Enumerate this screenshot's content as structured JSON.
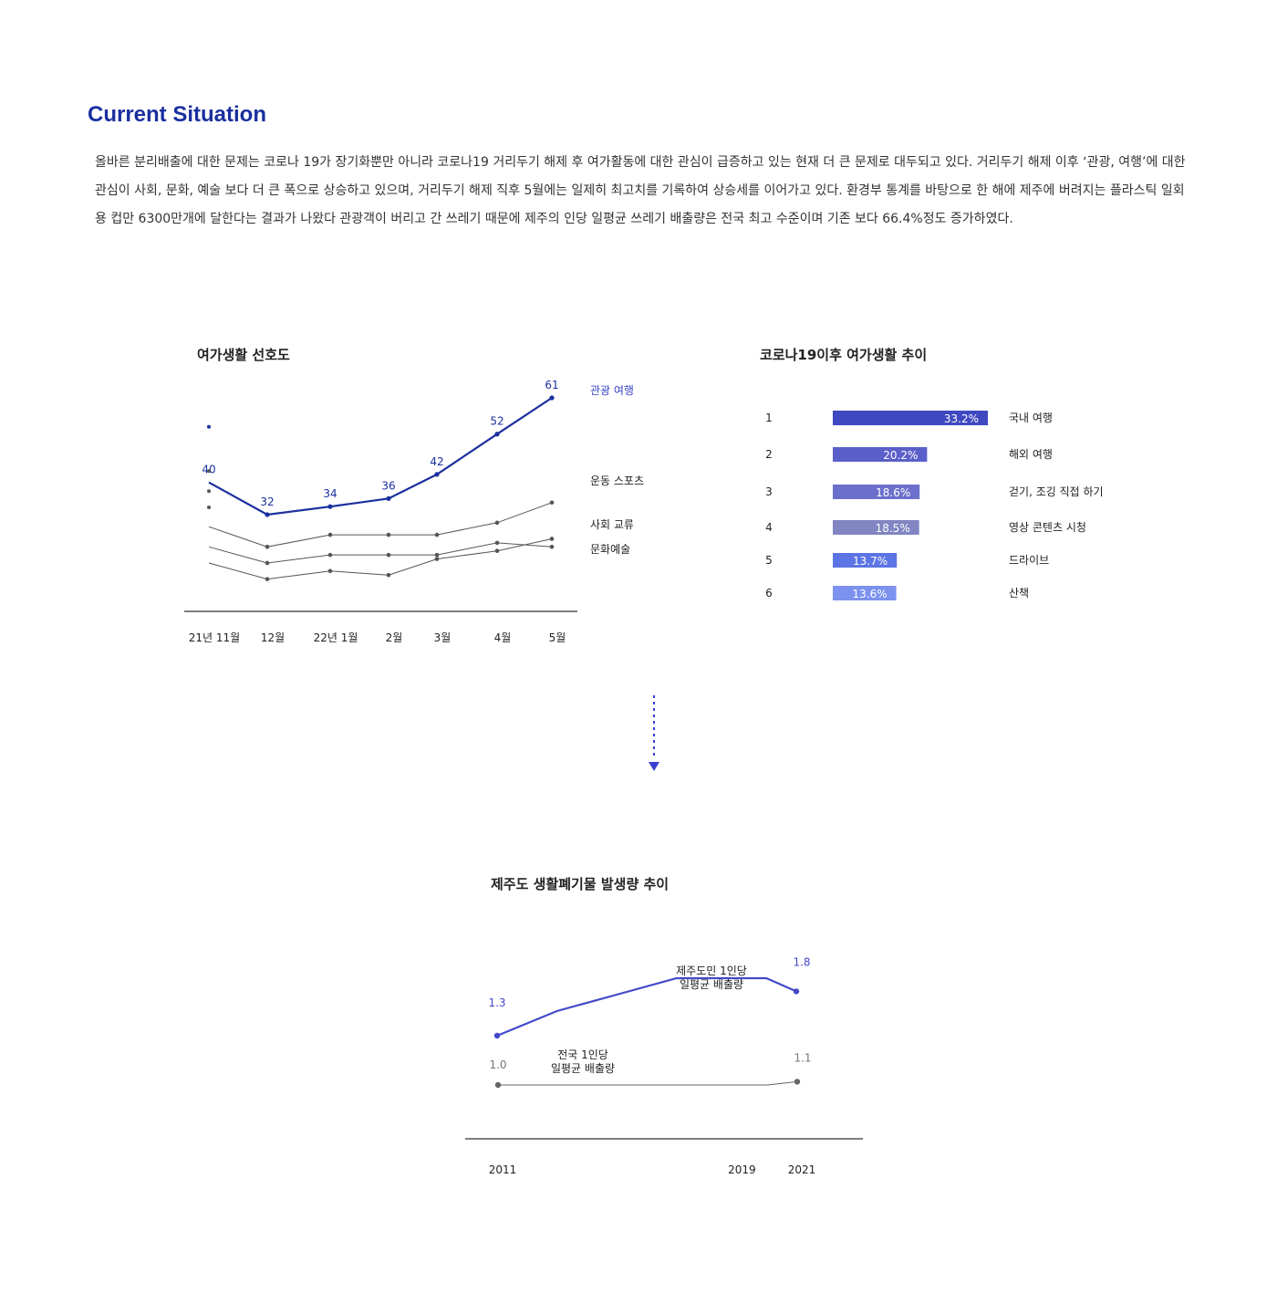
{
  "section": {
    "title": "Current Situation",
    "description": "올바른 분리배출에 대한 문제는 코로나 19가 장기화뿐만 아니라 코로나19 거리두기 해제 후 여가활동에 대한 관심이 급증하고 있는 현재 더 큰 문제로 대두되고 있다. 거리두기 해제 이후 ‘관광, 여행’에 대한 관심이 사회, 문화, 예술 보다 더 큰 폭으로 상승하고 있으며, 거리두기 해제 직후 5월에는 일제히 최고치를 기록하여 상승세를 이어가고 있다. 환경부 통계를 바탕으로 한 해에 제주에 버려지는 플라스틱 일회용 컵만 6300만개에 달한다는 결과가 나왔다 관광객이 버리고 간 쓰레기 때문에 제주의 인당 일평균 쓰레기 배출량은 전국 최고 수준이며 기존 보다 66.4%정도 증가하였다."
  },
  "chart_data": [
    {
      "type": "line",
      "title": "여가생활 선호도",
      "categories": [
        "21년 11월",
        "12월",
        "22년 1월",
        "2월",
        "3월",
        "4월",
        "5월"
      ],
      "series": [
        {
          "name": "관광 여행",
          "values": [
            40,
            32,
            34,
            36,
            42,
            52,
            61
          ],
          "labeled": true,
          "color": "#1a2f9e"
        },
        {
          "name": "운동 스포츠",
          "values": [
            29,
            24,
            27,
            27,
            27,
            30,
            35
          ],
          "labeled": false,
          "color": "#555555"
        },
        {
          "name": "사회 교류",
          "values": [
            24,
            20,
            22,
            22,
            22,
            25,
            24
          ],
          "labeled": false,
          "color": "#555555"
        },
        {
          "name": "문화예술",
          "values": [
            20,
            16,
            18,
            17,
            21,
            23,
            26
          ],
          "labeled": false,
          "color": "#555555"
        }
      ],
      "ylim": [
        0,
        65
      ],
      "legend": "right"
    },
    {
      "type": "bar",
      "orientation": "horizontal",
      "title": "코로나19이후 여가생활 추이",
      "ranks": [
        "1",
        "2",
        "3",
        "4",
        "5",
        "6"
      ],
      "categories": [
        "국내 여행",
        "해외 여행",
        "걷기, 조깅 직접 하기",
        "영상 콘텐츠 시청",
        "드라이브",
        "산책"
      ],
      "values": [
        33.2,
        20.2,
        18.6,
        18.5,
        13.7,
        13.6
      ],
      "value_labels": [
        "33.2%",
        "20.2%",
        "18.6%",
        "18.5%",
        "13.7%",
        "13.6%"
      ],
      "colors": [
        "#3e48c0",
        "#5b5fc9",
        "#6b70cc",
        "#8185c2",
        "#5c74e4",
        "#7c92ee"
      ]
    },
    {
      "type": "line",
      "title": "제주도 생활폐기물 발생량 추이",
      "x": [
        2011,
        2013,
        2015,
        2017,
        2019,
        2020,
        2021
      ],
      "tick_labels": [
        "2011",
        "2019",
        "2021"
      ],
      "tick_years": [
        2011,
        2019,
        2021
      ],
      "series": [
        {
          "name": "제주도민 1인당\n일평균 배출량",
          "values": [
            1.3,
            1.45,
            1.55,
            1.65,
            1.65,
            1.65,
            1.57
          ],
          "labels": {
            "start": "1.3",
            "end": "1.8"
          },
          "color": "#4349c9"
        },
        {
          "name": "전국 1인당\n일평균 배출량",
          "values": [
            1.0,
            1.0,
            1.0,
            1.0,
            1.0,
            1.0,
            1.02
          ],
          "labels": {
            "start": "1.0",
            "end": "1.1"
          },
          "color": "#666666"
        }
      ],
      "ylim": [
        0.85,
        1.75
      ]
    }
  ],
  "connector": {
    "color": "#3b3fd0",
    "icon": "arrow-down-icon"
  }
}
